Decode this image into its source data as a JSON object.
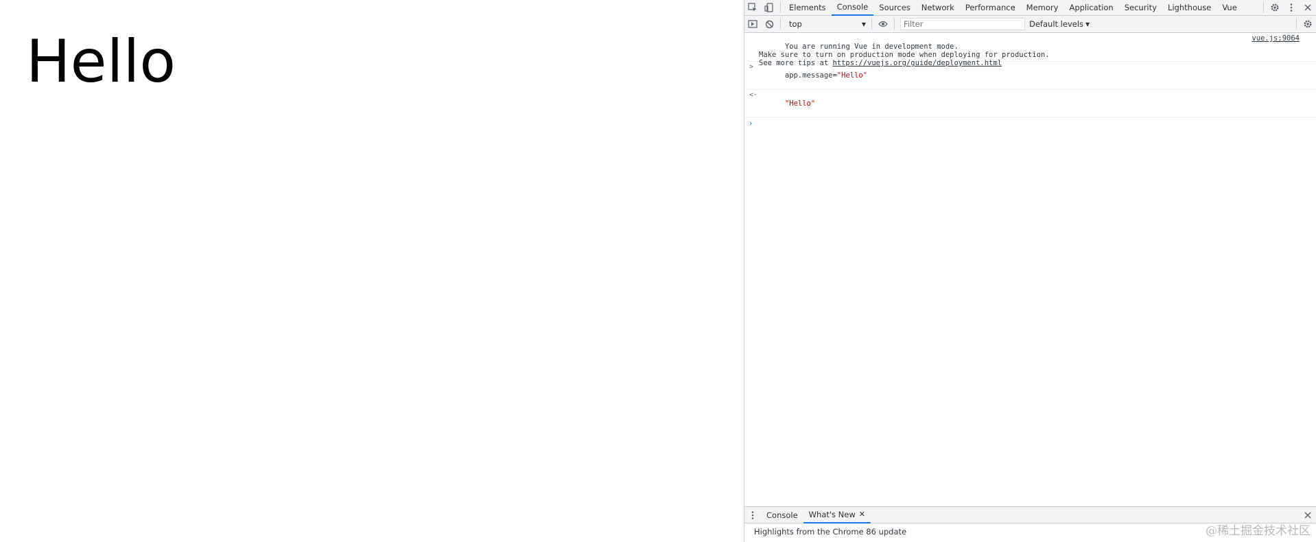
{
  "page": {
    "heading": "Hello"
  },
  "devtools": {
    "tabs": [
      "Elements",
      "Console",
      "Sources",
      "Network",
      "Performance",
      "Memory",
      "Application",
      "Security",
      "Lighthouse",
      "Vue"
    ],
    "active_tab": "Console",
    "console_toolbar": {
      "context": "top",
      "filter_placeholder": "Filter",
      "levels": "Default levels"
    },
    "messages": {
      "vue_info": {
        "line1": "You are running Vue in development mode.",
        "line2": "Make sure to turn on production mode when deploying for production.",
        "line3_prefix": "See more tips at ",
        "line3_link": "https://vuejs.org/guide/deployment.html",
        "source": "vue.js:9064"
      },
      "input": {
        "code": "app.message=",
        "string": "\"Hello\""
      },
      "output": {
        "value": "\"Hello\""
      }
    },
    "drawer": {
      "tabs": [
        "Console",
        "What's New"
      ],
      "active_tab": "What's New",
      "content": "Highlights from the Chrome 86 update"
    }
  },
  "watermark": "@稀土掘金技术社区",
  "colors": {
    "accent": "#1a73e8",
    "string": "#c80000",
    "toolbar_bg": "#f1f3f4"
  }
}
